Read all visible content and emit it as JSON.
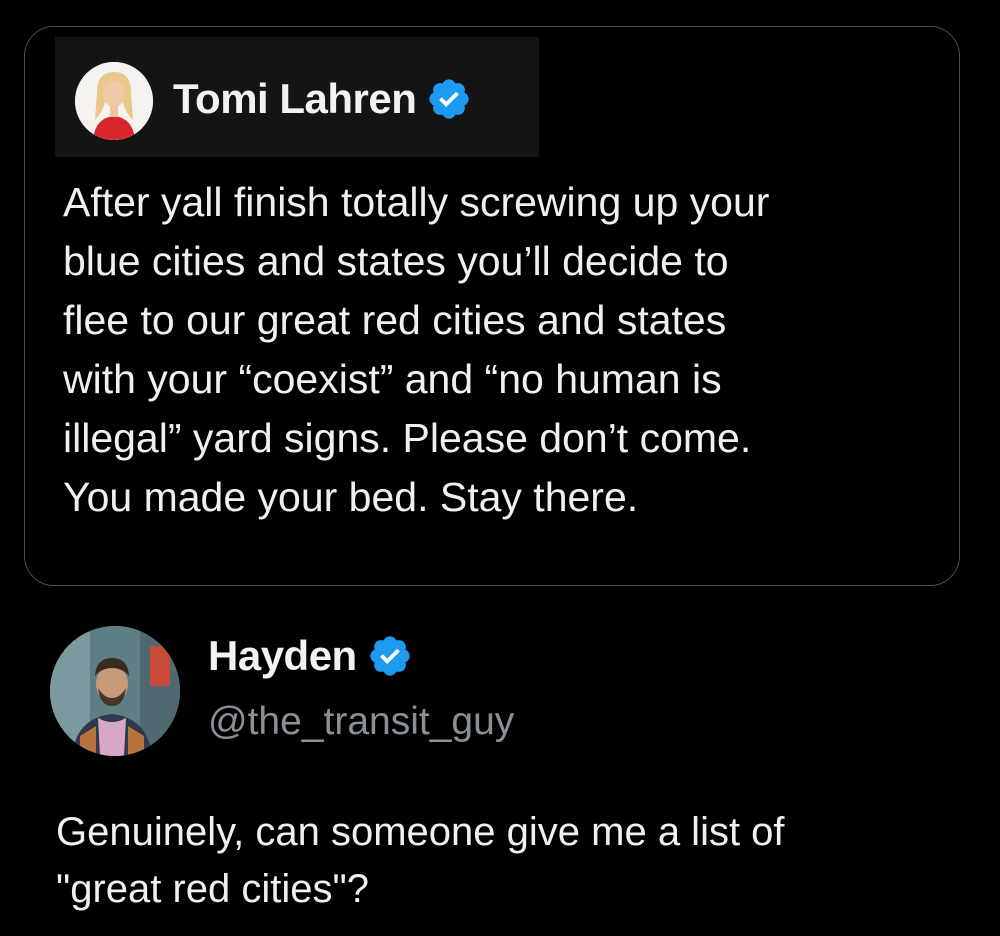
{
  "quoted_tweet": {
    "author_name": "Tomi Lahren",
    "verified_icon": "verified-badge-icon",
    "text": "After yall finish totally screwing up your\nblue cities and states you’ll decide to\nflee to our great red cities and states\nwith your “coexist” and “no human is\nillegal” yard signs. Please don’t come.\nYou made your bed. Stay there."
  },
  "reply_tweet": {
    "author_name": "Hayden",
    "handle": "@the_transit_guy",
    "verified_icon": "verified-badge-icon",
    "text": "Genuinely, can someone give me a list of\n\"great red cities\"?"
  },
  "colors": {
    "background": "#000000",
    "card_border": "#4a4d52",
    "text_primary": "#f0f0f0",
    "text_secondary": "#8b9096",
    "verified_blue": "#1d9bf0"
  }
}
